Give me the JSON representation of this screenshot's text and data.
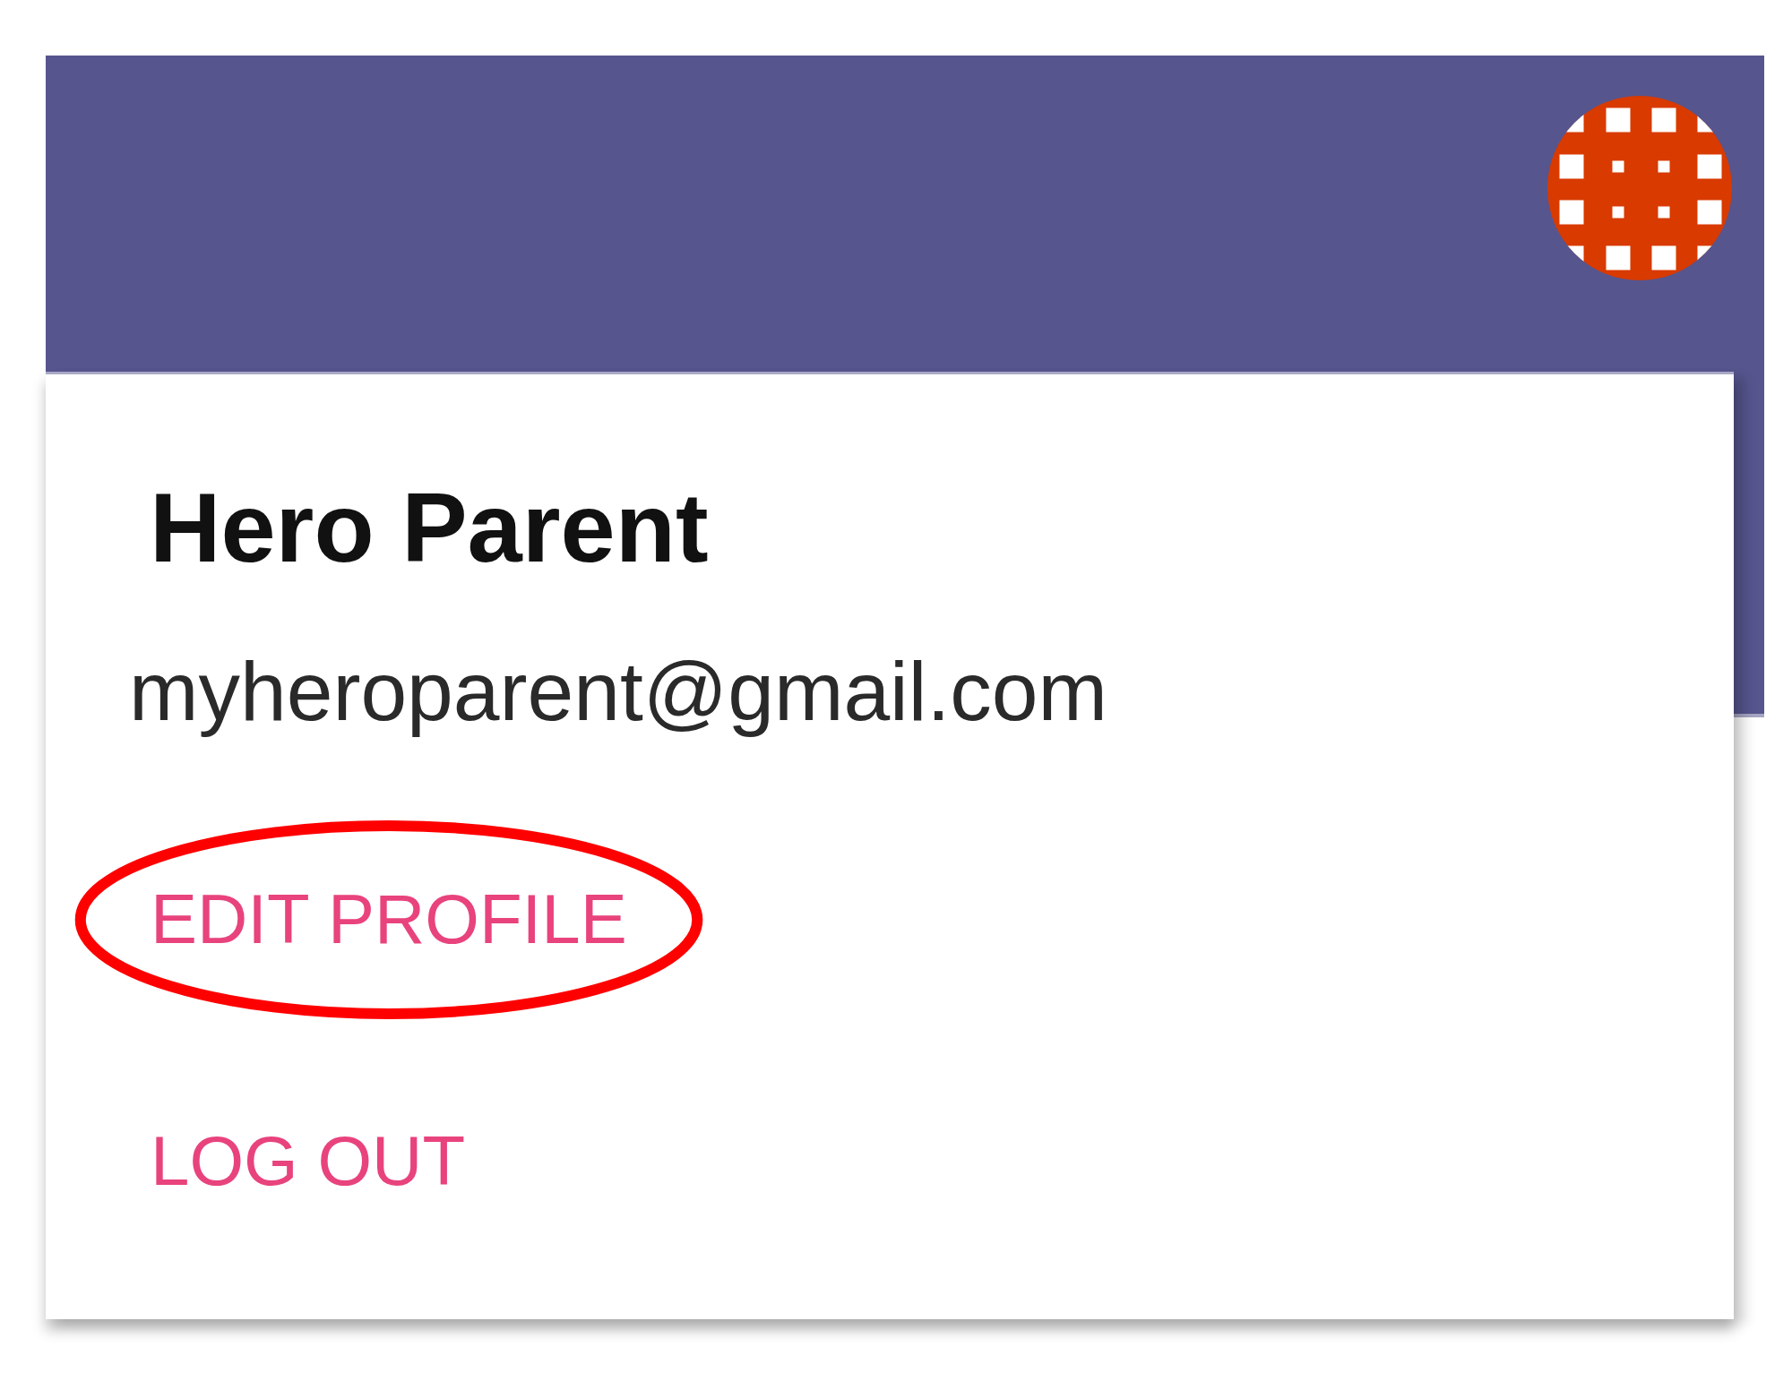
{
  "account_menu": {
    "name": "Hero Parent",
    "email": "myheroparent@gmail.com",
    "actions": [
      {
        "label": "EDIT PROFILE",
        "highlighted": true
      },
      {
        "label": "LOG OUT",
        "highlighted": false
      }
    ]
  }
}
